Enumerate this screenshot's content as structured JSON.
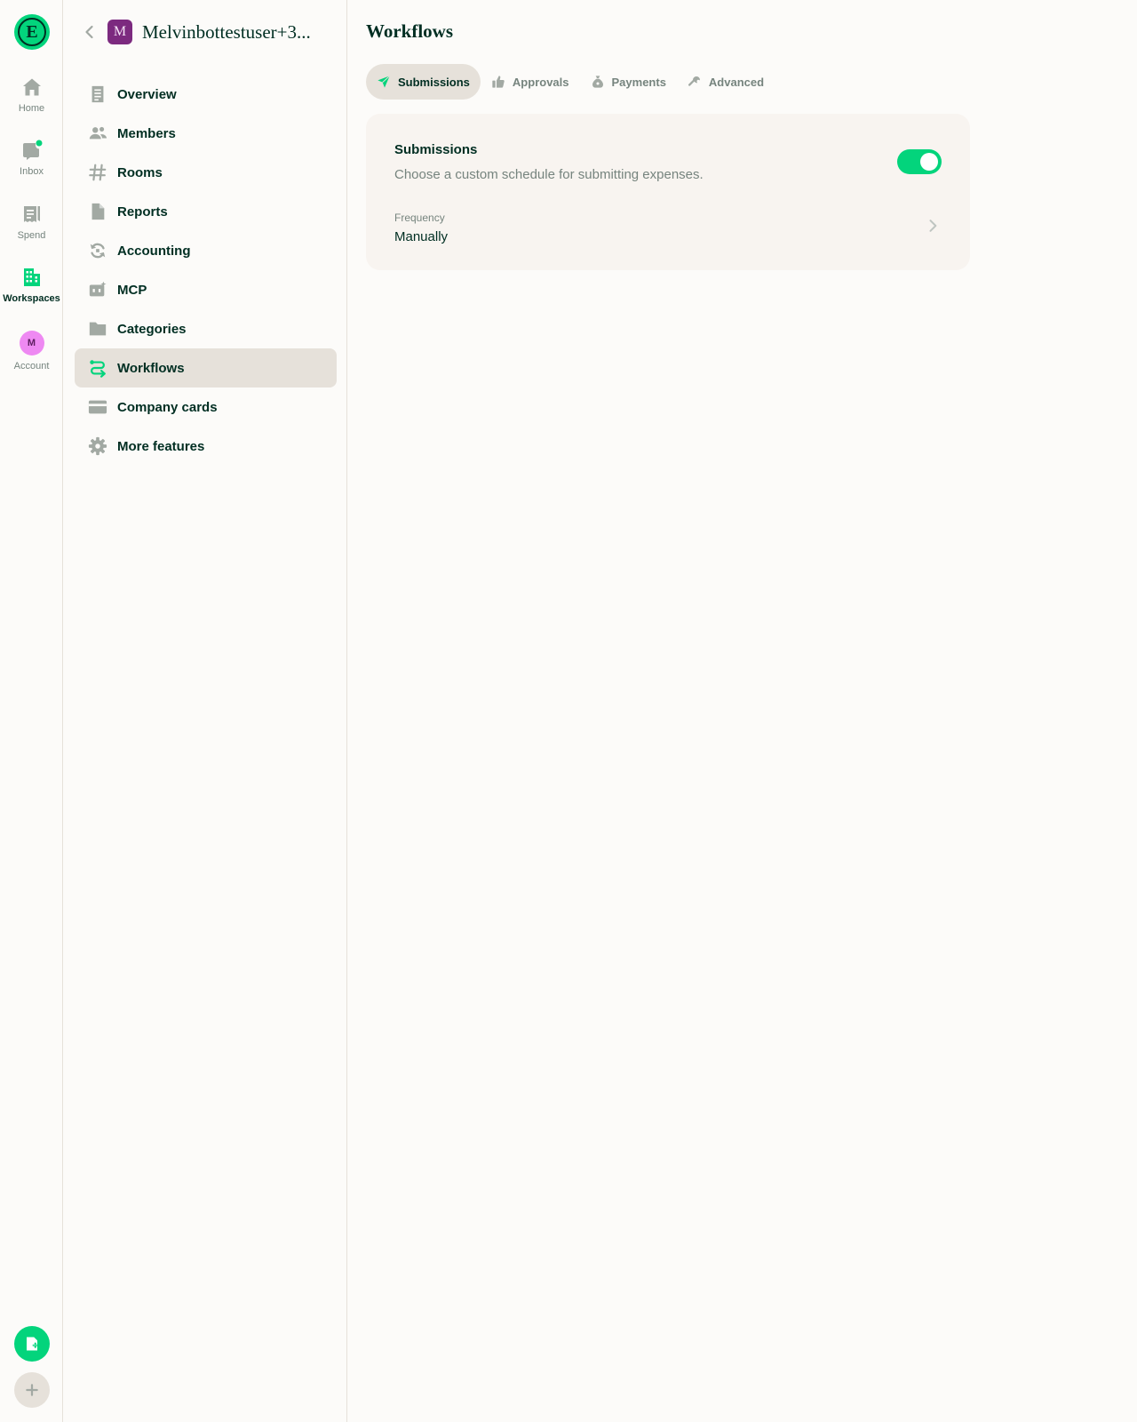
{
  "colors": {
    "accent": "#03d47c",
    "text_primary": "#002e22",
    "text_secondary": "#76847e",
    "icon": "#a2a9a3",
    "border": "#e6e1da",
    "card": "#f8f4f0",
    "background": "#fcfbf9"
  },
  "rail": {
    "logo_letter": "E",
    "items": [
      {
        "label": "Home",
        "icon": "home-icon"
      },
      {
        "label": "Inbox",
        "icon": "inbox-icon"
      },
      {
        "label": "Spend",
        "icon": "receipt-icon"
      },
      {
        "label": "Workspaces",
        "icon": "building-icon"
      },
      {
        "label": "Account",
        "icon": "avatar",
        "avatar_letter": "M"
      }
    ],
    "active": "Workspaces",
    "bottom_buttons": [
      {
        "icon": "new-expense-icon"
      },
      {
        "icon": "plus-icon"
      }
    ]
  },
  "sidebar": {
    "workspace_avatar_letter": "M",
    "workspace_name": "Melvinbottestuser+3...",
    "items": [
      {
        "label": "Overview",
        "icon": "document-icon"
      },
      {
        "label": "Members",
        "icon": "users-icon"
      },
      {
        "label": "Rooms",
        "icon": "hashtag-icon"
      },
      {
        "label": "Reports",
        "icon": "file-icon"
      },
      {
        "label": "Accounting",
        "icon": "sync-icon"
      },
      {
        "label": "MCP",
        "icon": "robot-icon"
      },
      {
        "label": "Categories",
        "icon": "folder-icon"
      },
      {
        "label": "Workflows",
        "icon": "workflow-icon"
      },
      {
        "label": "Company cards",
        "icon": "credit-card-icon"
      },
      {
        "label": "More features",
        "icon": "gear-icon"
      }
    ],
    "active": "Workflows"
  },
  "main": {
    "title": "Workflows",
    "tabs": [
      {
        "label": "Submissions",
        "icon": "paper-plane-icon"
      },
      {
        "label": "Approvals",
        "icon": "thumbs-up-icon"
      },
      {
        "label": "Payments",
        "icon": "money-bag-icon"
      },
      {
        "label": "Advanced",
        "icon": "wrench-icon"
      }
    ],
    "active_tab": "Submissions",
    "card": {
      "title": "Submissions",
      "description": "Choose a custom schedule for submitting expenses.",
      "toggle_on": true,
      "frequency_label": "Frequency",
      "frequency_value": "Manually"
    }
  }
}
